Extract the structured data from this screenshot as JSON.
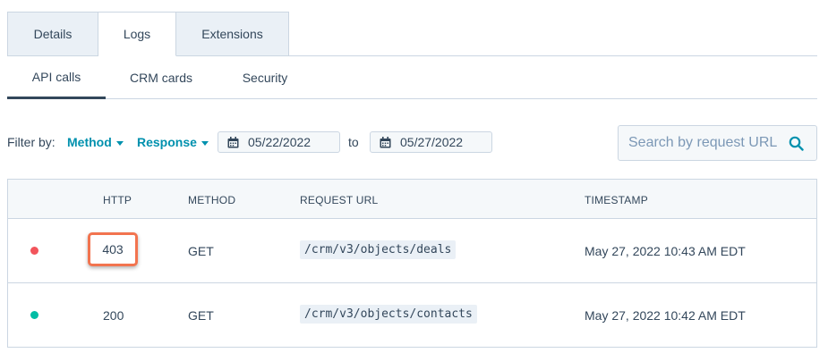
{
  "top_tabs": [
    {
      "label": "Details",
      "active": false
    },
    {
      "label": "Logs",
      "active": true
    },
    {
      "label": "Extensions",
      "active": false
    }
  ],
  "sub_tabs": [
    {
      "label": "API calls",
      "active": true
    },
    {
      "label": "CRM cards",
      "active": false
    },
    {
      "label": "Security",
      "active": false
    }
  ],
  "filter": {
    "label": "Filter by:",
    "method_label": "Method",
    "response_label": "Response",
    "date_from": "05/22/2022",
    "to_label": "to",
    "date_to": "05/27/2022"
  },
  "search": {
    "placeholder": "Search by request URL",
    "value": ""
  },
  "table": {
    "headers": {
      "http": "HTTP",
      "method": "METHOD",
      "url": "REQUEST URL",
      "timestamp": "TIMESTAMP"
    },
    "rows": [
      {
        "status": "error",
        "status_color": "#f2545b",
        "http": "403",
        "method": "GET",
        "url": "/crm/v3/objects/deals",
        "timestamp": "May 27, 2022 10:43 AM EDT",
        "highlighted": true
      },
      {
        "status": "success",
        "status_color": "#00bda5",
        "http": "200",
        "method": "GET",
        "url": "/crm/v3/objects/contacts",
        "timestamp": "May 27, 2022 10:42 AM EDT",
        "highlighted": false
      }
    ]
  },
  "colors": {
    "accent": "#0091ae",
    "highlight_border": "#f2744f",
    "text": "#33475b",
    "border": "#cbd6e2"
  },
  "icons": {
    "calendar": "calendar-icon",
    "search": "search-icon",
    "caret": "caret-down-icon"
  }
}
